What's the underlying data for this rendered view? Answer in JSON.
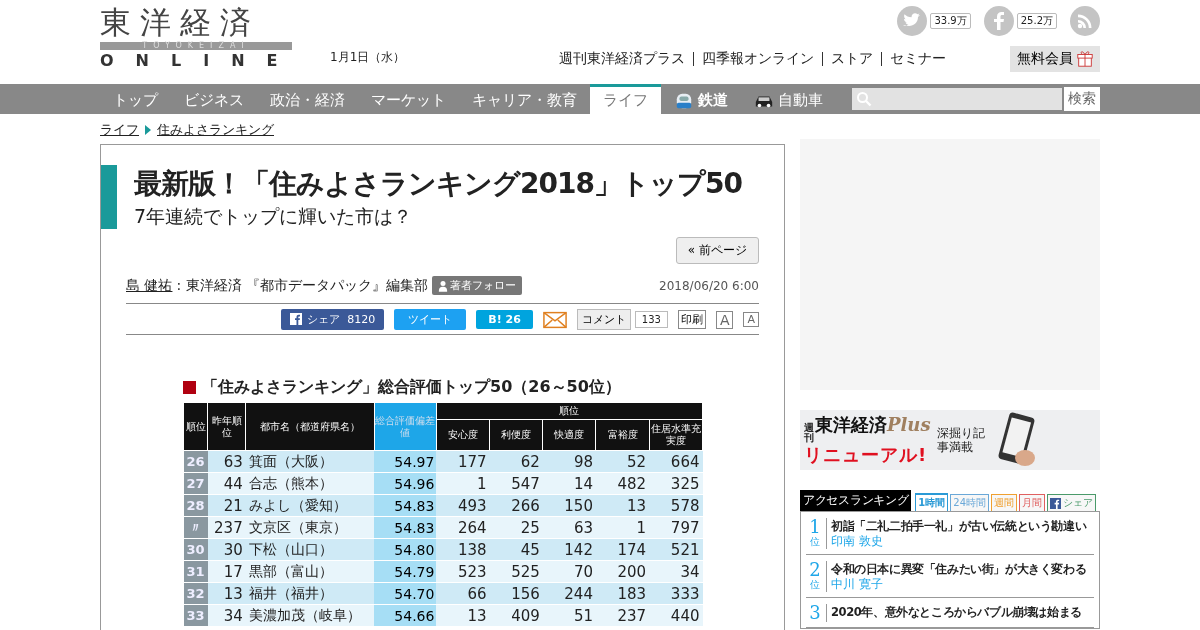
{
  "header": {
    "logo": {
      "title": "東洋経済",
      "roman": "TOYOKEIZAI",
      "online": "ONLINE"
    },
    "date": "1月1日（水）",
    "social": [
      {
        "kind": "twitter",
        "count": "33.9万"
      },
      {
        "kind": "facebook",
        "count": "25.2万"
      },
      {
        "kind": "rss"
      }
    ],
    "links": [
      "週刊東洋経済プラス",
      "四季報オンライン",
      "ストア",
      "セミナー"
    ],
    "member_button": "無料会員"
  },
  "nav": {
    "items": [
      {
        "label": "トップ",
        "kind": "text",
        "selected": false
      },
      {
        "label": "ビジネス",
        "kind": "text",
        "selected": false
      },
      {
        "label": "政治・経済",
        "kind": "text",
        "selected": false
      },
      {
        "label": "マーケット",
        "kind": "text",
        "selected": false
      },
      {
        "label": "キャリア・教育",
        "kind": "text",
        "selected": false
      },
      {
        "label": "ライフ",
        "kind": "text",
        "selected": true
      },
      {
        "label": "鉄道",
        "kind": "rail",
        "selected": false
      },
      {
        "label": "自動車",
        "kind": "car",
        "selected": false
      }
    ],
    "search": {
      "button": "検索"
    }
  },
  "breadcrumb": [
    "ライフ",
    "住みよさランキング"
  ],
  "article": {
    "title": "最新版！「住みよさランキング2018」トップ50",
    "subtitle": "7年連続でトップに輝いた市は？",
    "prev_button": "« 前ページ",
    "author": "島 健祐",
    "affiliation": ": 東洋経済 『都市データパック』編集部",
    "follow_button": "著者フォロー",
    "date": "2018/06/20 6:00",
    "share": {
      "facebook": {
        "label": "シェア",
        "count": "8120"
      },
      "tweet": "ツイート",
      "hatena": {
        "label": "B!",
        "count": "26"
      },
      "comment": {
        "label": "コメント",
        "count": "133"
      },
      "print": "印刷",
      "font_sizes": [
        "A",
        "A"
      ]
    },
    "figure": {
      "title": "「住みよさランキング」総合評価トップ50（26～50位）",
      "columns": [
        "順位",
        "昨年順位",
        "都市名（都道府県名）",
        "総合評価偏差値"
      ],
      "group_heading": "順位",
      "sub_columns": [
        "安心度",
        "利便度",
        "快適度",
        "富裕度",
        "住居水準充実度"
      ],
      "rows": [
        {
          "rank": "26",
          "last": "63",
          "city": "箕面（大阪）",
          "score": "54.97",
          "values": [
            "177",
            "62",
            "98",
            "52",
            "664"
          ]
        },
        {
          "rank": "27",
          "last": "44",
          "city": "合志（熊本）",
          "score": "54.96",
          "values": [
            "1",
            "547",
            "14",
            "482",
            "325"
          ]
        },
        {
          "rank": "28",
          "last": "21",
          "city": "みよし（愛知）",
          "score": "54.83",
          "values": [
            "493",
            "266",
            "150",
            "13",
            "578"
          ]
        },
        {
          "rank": "〃",
          "last": "237",
          "city": "文京区（東京）",
          "score": "54.83",
          "values": [
            "264",
            "25",
            "63",
            "1",
            "797"
          ]
        },
        {
          "rank": "30",
          "last": "30",
          "city": "下松（山口）",
          "score": "54.80",
          "values": [
            "138",
            "45",
            "142",
            "174",
            "521"
          ]
        },
        {
          "rank": "31",
          "last": "17",
          "city": "黒部（富山）",
          "score": "54.79",
          "values": [
            "523",
            "525",
            "70",
            "200",
            "34"
          ]
        },
        {
          "rank": "32",
          "last": "13",
          "city": "福井（福井）",
          "score": "54.70",
          "values": [
            "66",
            "156",
            "244",
            "183",
            "333"
          ]
        },
        {
          "rank": "33",
          "last": "34",
          "city": "美濃加茂（岐阜）",
          "score": "54.66",
          "values": [
            "13",
            "409",
            "51",
            "237",
            "440"
          ]
        }
      ]
    }
  },
  "sidebar": {
    "banner": {
      "small": "週刊",
      "brand": "東洋経済",
      "plus": "Plus",
      "renewal": "リニューアル!",
      "tagline": "深掘り記事満載"
    },
    "ranking": {
      "title": "アクセスランキング",
      "tabs": [
        {
          "label": "1時間",
          "color": "#2a9ad6",
          "selected": true
        },
        {
          "label": "24時間",
          "color": "#6aa8d8",
          "selected": false
        },
        {
          "label": "週間",
          "color": "#f0a030",
          "selected": false
        },
        {
          "label": "月間",
          "color": "#e06060",
          "selected": false
        },
        {
          "label": "シェア",
          "color": "#4a9a6a",
          "selected": false,
          "kind": "facebook"
        }
      ],
      "items": [
        {
          "rank": "1",
          "suffix": "位",
          "title": "初詣「二礼二拍手一礼」が古い伝統という勘違い",
          "author": "印南 敦史"
        },
        {
          "rank": "2",
          "suffix": "位",
          "title": "令和の日本に異変「住みたい街」が大きく変わる",
          "author": "中川 寛子"
        },
        {
          "rank": "3",
          "title": "2020年、意外なところからバブル崩壊は始まる"
        }
      ]
    }
  }
}
